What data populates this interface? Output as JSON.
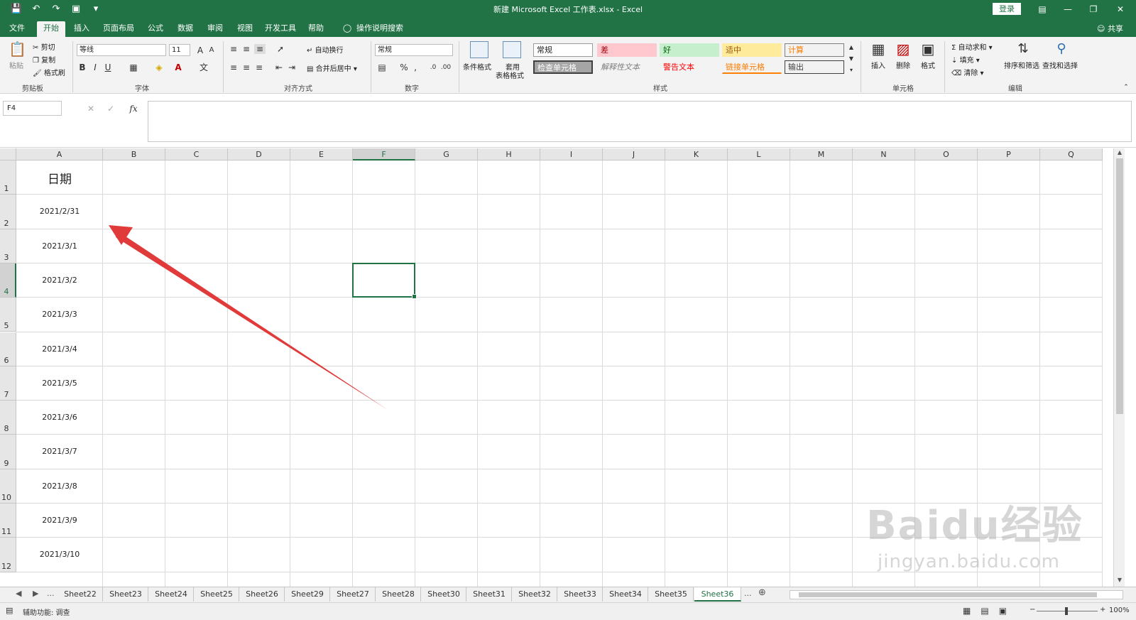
{
  "window": {
    "title": "新建 Microsoft Excel 工作表.xlsx - Excel",
    "login": "登录"
  },
  "tabs": [
    "文件",
    "开始",
    "插入",
    "页面布局",
    "公式",
    "数据",
    "审阅",
    "视图",
    "开发工具",
    "帮助",
    "操作说明搜索"
  ],
  "active_tab": "开始",
  "share": "共享",
  "ribbon": {
    "clipboard": {
      "paste": "粘贴",
      "cut": "剪切",
      "copy": "复制",
      "format_painter": "格式刷",
      "label": "剪贴板"
    },
    "font": {
      "name": "等线",
      "size": "11",
      "label": "字体"
    },
    "alignment": {
      "wrap": "自动换行",
      "merge": "合并后居中",
      "label": "对齐方式"
    },
    "number": {
      "format": "常规",
      "label": "数字"
    },
    "styles": {
      "conditional": "条件格式",
      "table": [
        "套用",
        "表格格式"
      ],
      "cells": [
        "常规",
        "差",
        "好",
        "适中",
        "计算",
        "检查单元格",
        "解释性文本",
        "警告文本",
        "链接单元格",
        "输出"
      ],
      "label": "样式"
    },
    "cells": {
      "insert": "插入",
      "delete": "删除",
      "format": "格式",
      "label": "单元格"
    },
    "editing": {
      "autosum": "自动求和",
      "fill": "填充",
      "clear": "清除",
      "sort": "排序和筛选",
      "find": "查找和选择",
      "label": "编辑"
    }
  },
  "formula_bar": {
    "name_box": "F4",
    "fx": "fx",
    "content": ""
  },
  "columns": [
    "A",
    "B",
    "C",
    "D",
    "E",
    "F",
    "G",
    "H",
    "I",
    "J",
    "K",
    "L",
    "M",
    "N",
    "O",
    "P",
    "Q"
  ],
  "selected_column": "F",
  "rows": [
    "1",
    "2",
    "3",
    "4",
    "5",
    "6",
    "7",
    "8",
    "9",
    "10",
    "11",
    "12"
  ],
  "selected_row": "4",
  "column_a": [
    "日期",
    "2021/2/31",
    "2021/3/1",
    "2021/3/2",
    "2021/3/3",
    "2021/3/4",
    "2021/3/5",
    "2021/3/6",
    "2021/3/7",
    "2021/3/8",
    "2021/3/9",
    "2021/3/10"
  ],
  "sheets": [
    "Sheet22",
    "Sheet23",
    "Sheet24",
    "Sheet25",
    "Sheet26",
    "Sheet29",
    "Sheet27",
    "Sheet28",
    "Sheet30",
    "Sheet31",
    "Sheet32",
    "Sheet33",
    "Sheet34",
    "Sheet35",
    "Sheet36"
  ],
  "active_sheet": "Sheet36",
  "status": {
    "accessibility": "辅助功能: 调查",
    "zoom": "100%"
  },
  "watermark": {
    "brand": "Baidu经验",
    "url": "jingyan.baidu.com"
  },
  "colors": {
    "accent": "#217346",
    "arrow": "#e03a3a"
  }
}
